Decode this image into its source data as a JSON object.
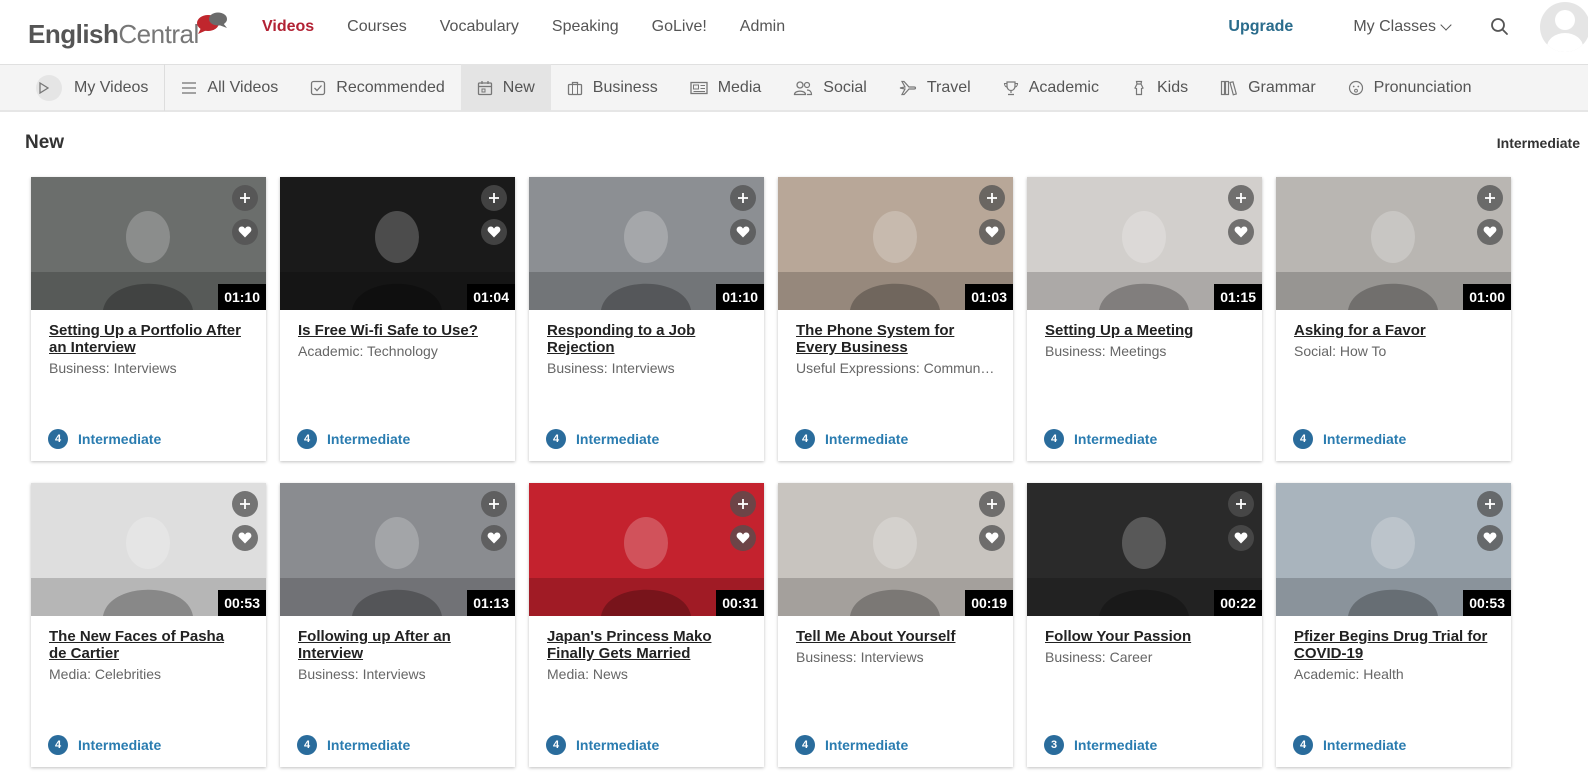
{
  "brand": {
    "english": "English",
    "central": "Central"
  },
  "nav": [
    {
      "label": "Videos",
      "active": true
    },
    {
      "label": "Courses"
    },
    {
      "label": "Vocabulary"
    },
    {
      "label": "Speaking"
    },
    {
      "label": "GoLive!"
    },
    {
      "label": "Admin"
    }
  ],
  "header_right": {
    "upgrade": "Upgrade",
    "my_classes": "My Classes"
  },
  "categories": [
    {
      "label": "My Videos",
      "icon": "play-icon"
    },
    {
      "label": "All Videos",
      "icon": "list-icon"
    },
    {
      "label": "Recommended",
      "icon": "check-box-icon"
    },
    {
      "label": "New",
      "icon": "calendar-icon",
      "active": true
    },
    {
      "label": "Business",
      "icon": "briefcase-icon"
    },
    {
      "label": "Media",
      "icon": "newspaper-icon"
    },
    {
      "label": "Social",
      "icon": "people-icon"
    },
    {
      "label": "Travel",
      "icon": "plane-icon"
    },
    {
      "label": "Academic",
      "icon": "trophy-icon"
    },
    {
      "label": "Kids",
      "icon": "shirt-icon"
    },
    {
      "label": "Grammar",
      "icon": "books-icon"
    },
    {
      "label": "Pronunciation",
      "icon": "face-icon"
    }
  ],
  "section": {
    "title": "New",
    "level_filter": "Intermediate"
  },
  "videos": [
    {
      "title": "Setting Up a Portfolio After an Interview",
      "category": "Business: Interviews",
      "duration": "01:10",
      "level": "4",
      "level_name": "Intermediate",
      "bg": "#6b6e6c"
    },
    {
      "title": "Is Free Wi-fi Safe to Use?",
      "category": "Academic: Technology",
      "duration": "01:04",
      "level": "4",
      "level_name": "Intermediate",
      "bg": "#1a1a1a"
    },
    {
      "title": "Responding to a Job Rejection",
      "category": "Business: Interviews",
      "duration": "01:10",
      "level": "4",
      "level_name": "Intermediate",
      "bg": "#8c8f93"
    },
    {
      "title": "The Phone System for Every Business",
      "category": "Useful Expressions: Communication",
      "duration": "01:03",
      "level": "4",
      "level_name": "Intermediate",
      "bg": "#b8a798"
    },
    {
      "title": "Setting Up a Meeting",
      "category": "Business: Meetings",
      "duration": "01:15",
      "level": "4",
      "level_name": "Intermediate",
      "bg": "#d2cfcc"
    },
    {
      "title": "Asking for a Favor",
      "category": "Social: How To",
      "duration": "01:00",
      "level": "4",
      "level_name": "Intermediate",
      "bg": "#b9b6b2"
    },
    {
      "title": "The New Faces of Pasha de Cartier",
      "category": "Media: Celebrities",
      "duration": "00:53",
      "level": "4",
      "level_name": "Intermediate",
      "bg": "#dedede"
    },
    {
      "title": "Following up After an Interview",
      "category": "Business: Interviews",
      "duration": "01:13",
      "level": "4",
      "level_name": "Intermediate",
      "bg": "#8a8c90"
    },
    {
      "title": "Japan's Princess Mako Finally Gets Married",
      "category": "Media: News",
      "duration": "00:31",
      "level": "4",
      "level_name": "Intermediate",
      "bg": "#c4222e"
    },
    {
      "title": "Tell Me About Yourself",
      "category": "Business: Interviews",
      "duration": "00:19",
      "level": "4",
      "level_name": "Intermediate",
      "bg": "#c8c4bf"
    },
    {
      "title": "Follow Your Passion",
      "category": "Business: Career",
      "duration": "00:22",
      "level": "3",
      "level_name": "Intermediate",
      "bg": "#2a2a2a"
    },
    {
      "title": "Pfizer Begins Drug Trial for COVID-19",
      "category": "Academic: Health",
      "duration": "00:53",
      "level": "4",
      "level_name": "Intermediate",
      "bg": "#a9b4bd"
    }
  ]
}
